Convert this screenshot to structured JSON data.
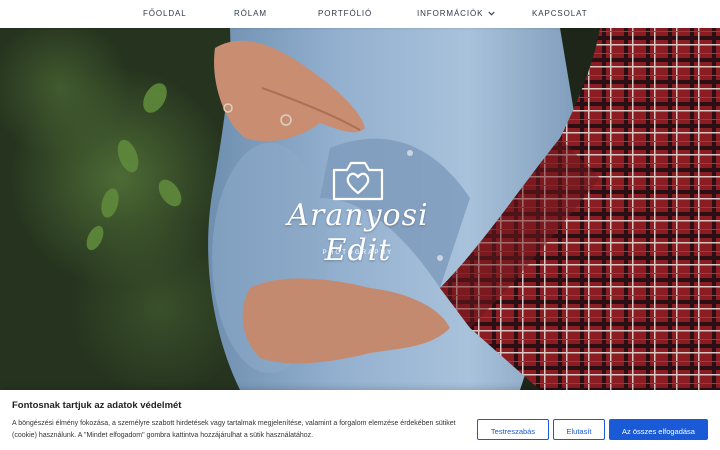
{
  "nav": {
    "items": [
      {
        "label": "FŐOLDAL"
      },
      {
        "label": "RÓLAM"
      },
      {
        "label": "PORTFÓLIÓ"
      },
      {
        "label": "INFORMÁCIÓK",
        "has_dropdown": true,
        "icon": "chevron-down-icon"
      },
      {
        "label": "KAPCSOLAT"
      }
    ]
  },
  "hero": {
    "logo": {
      "icon": "camera-heart-icon",
      "script_text": "Aranyosi Edit",
      "tagline": "PHOTOGRAPHY"
    }
  },
  "consent": {
    "title": "Fontosnak tartjuk az adatok védelmét",
    "text": "A böngészési élmény fokozása, a személyre szabott hirdetések vagy tartalmak megjelenítése, valamint a forgalom elemzése érdekében sütiket (cookie) használunk. A \"Mindet elfogadom\" gombra kattintva hozzájárulhat a sütik használatához.",
    "buttons": {
      "customize": "Testreszabás",
      "reject": "Elutasít",
      "accept_all": "Az összes elfogadása"
    }
  },
  "colors": {
    "accent": "#1a5ad6",
    "nav_text": "#2f3a4a"
  }
}
